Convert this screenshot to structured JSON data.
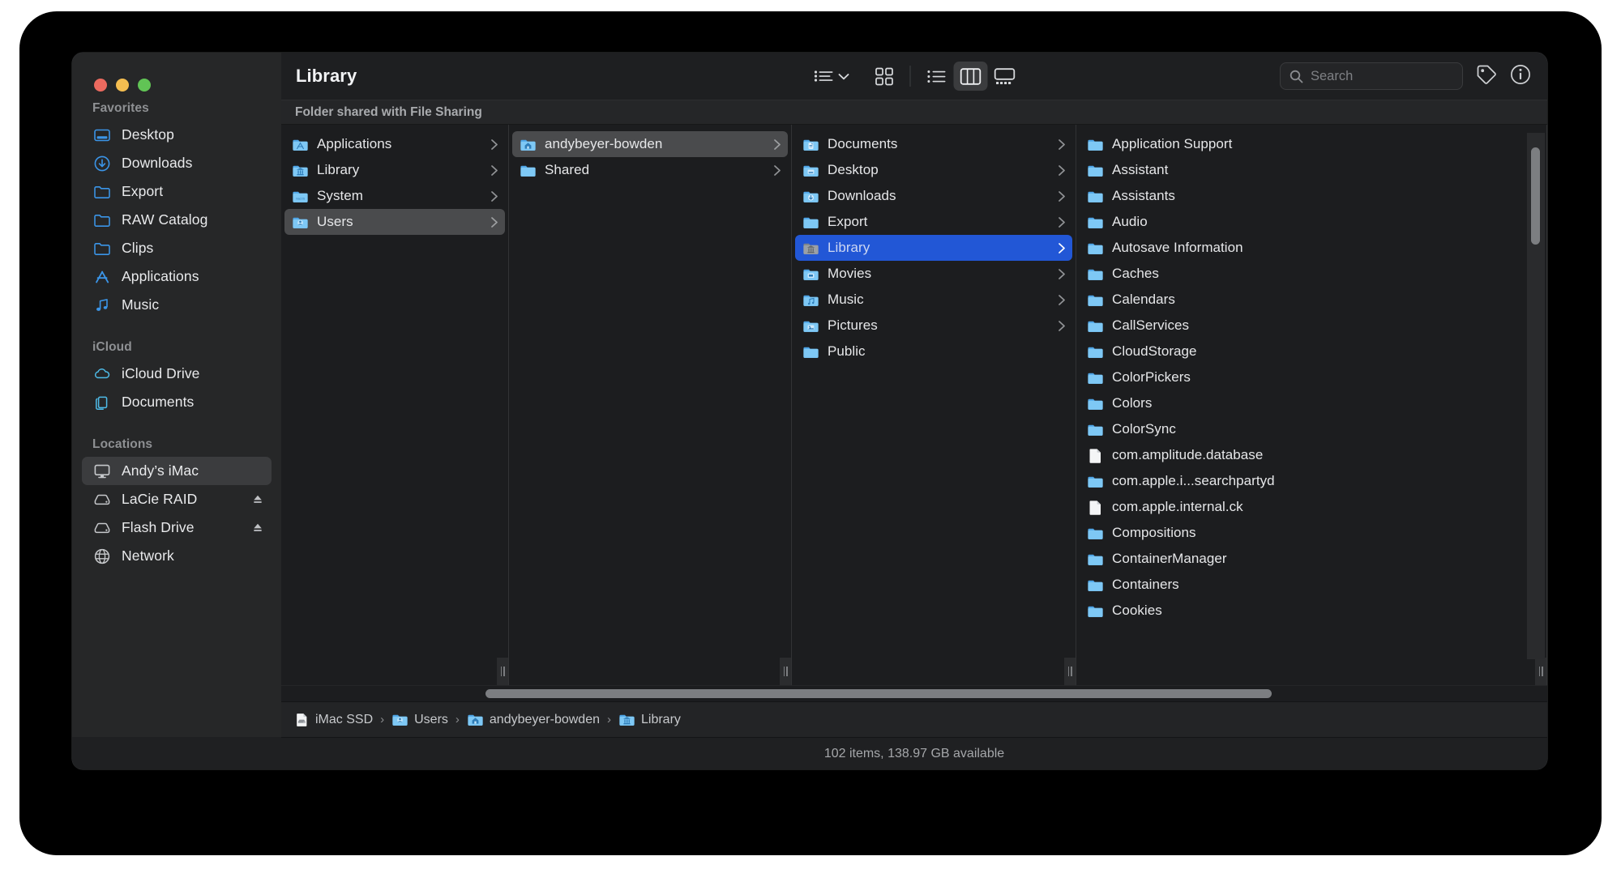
{
  "window": {
    "title": "Library",
    "banner": "Folder shared with File Sharing"
  },
  "traffic_lights": {
    "close": "close-button",
    "minimize": "minimize-button",
    "zoom": "zoom-button",
    "colors": {
      "close": "#ec6a5f",
      "minimize": "#f4bd50",
      "zoom": "#61c455"
    }
  },
  "sidebar": {
    "groups": [
      {
        "title": "Favorites",
        "items": [
          {
            "label": "Desktop",
            "icon": "desktop-icon",
            "selected": false,
            "eject": false
          },
          {
            "label": "Downloads",
            "icon": "downloads-icon",
            "selected": false,
            "eject": false
          },
          {
            "label": "Export",
            "icon": "folder-icon",
            "selected": false,
            "eject": false
          },
          {
            "label": "RAW Catalog",
            "icon": "folder-icon",
            "selected": false,
            "eject": false
          },
          {
            "label": "Clips",
            "icon": "folder-icon",
            "selected": false,
            "eject": false
          },
          {
            "label": "Applications",
            "icon": "applications-icon",
            "selected": false,
            "eject": false
          },
          {
            "label": "Music",
            "icon": "music-note-icon",
            "selected": false,
            "eject": false
          }
        ]
      },
      {
        "title": "iCloud",
        "items": [
          {
            "label": "iCloud Drive",
            "icon": "cloud-icon",
            "selected": false,
            "eject": false
          },
          {
            "label": "Documents",
            "icon": "documents-icon",
            "selected": false,
            "eject": false
          }
        ]
      },
      {
        "title": "Locations",
        "items": [
          {
            "label": "Andy’s iMac",
            "icon": "imac-icon",
            "selected": true,
            "eject": false
          },
          {
            "label": "LaCie RAID",
            "icon": "disk-icon",
            "selected": false,
            "eject": true
          },
          {
            "label": "Flash Drive",
            "icon": "disk-icon",
            "selected": false,
            "eject": true
          },
          {
            "label": "Network",
            "icon": "globe-icon",
            "selected": false,
            "eject": false
          }
        ]
      }
    ]
  },
  "toolbar": {
    "group_button": "group-by-button",
    "chevron": "chevron-down-icon",
    "view_buttons": [
      {
        "name": "icon-view-button",
        "active": false
      },
      {
        "name": "list-view-button",
        "active": false
      },
      {
        "name": "column-view-button",
        "active": true
      },
      {
        "name": "gallery-view-button",
        "active": false
      }
    ],
    "search_placeholder": "Search",
    "tag_button": "tag-icon",
    "info_button": "info-icon"
  },
  "columns": [
    {
      "name": "column-1",
      "items": [
        {
          "label": "Applications",
          "icon": "folder-applications",
          "chevron": true,
          "selected": "none"
        },
        {
          "label": "Library",
          "icon": "folder-library",
          "chevron": true,
          "selected": "none"
        },
        {
          "label": "System",
          "icon": "folder-system",
          "chevron": true,
          "selected": "none"
        },
        {
          "label": "Users",
          "icon": "folder-users",
          "chevron": true,
          "selected": "gray"
        }
      ]
    },
    {
      "name": "column-2",
      "items": [
        {
          "label": "andybeyer-bowden",
          "icon": "folder-home",
          "chevron": true,
          "selected": "gray"
        },
        {
          "label": "Shared",
          "icon": "folder-plain",
          "chevron": true,
          "selected": "none"
        }
      ]
    },
    {
      "name": "column-3",
      "items": [
        {
          "label": "Documents",
          "icon": "folder-documents",
          "chevron": true,
          "selected": "none"
        },
        {
          "label": "Desktop",
          "icon": "folder-desktop",
          "chevron": true,
          "selected": "none"
        },
        {
          "label": "Downloads",
          "icon": "folder-downloads",
          "chevron": true,
          "selected": "none"
        },
        {
          "label": "Export",
          "icon": "folder-plain",
          "chevron": true,
          "selected": "none"
        },
        {
          "label": "Library",
          "icon": "folder-library-dim",
          "chevron": true,
          "selected": "blue"
        },
        {
          "label": "Movies",
          "icon": "folder-movies",
          "chevron": true,
          "selected": "none"
        },
        {
          "label": "Music",
          "icon": "folder-music",
          "chevron": true,
          "selected": "none"
        },
        {
          "label": "Pictures",
          "icon": "folder-pictures",
          "chevron": true,
          "selected": "none"
        },
        {
          "label": "Public",
          "icon": "folder-plain",
          "chevron": false,
          "selected": "none"
        }
      ]
    },
    {
      "name": "column-4",
      "items": [
        {
          "label": "Application Support",
          "icon": "folder-plain",
          "chevron": true,
          "selected": "none"
        },
        {
          "label": "Assistant",
          "icon": "folder-plain",
          "chevron": true,
          "selected": "none"
        },
        {
          "label": "Assistants",
          "icon": "folder-plain",
          "chevron": true,
          "selected": "none"
        },
        {
          "label": "Audio",
          "icon": "folder-plain",
          "chevron": true,
          "selected": "none"
        },
        {
          "label": "Autosave Information",
          "icon": "folder-plain",
          "chevron": true,
          "selected": "none"
        },
        {
          "label": "Caches",
          "icon": "folder-plain",
          "chevron": true,
          "selected": "none"
        },
        {
          "label": "Calendars",
          "icon": "folder-plain",
          "chevron": true,
          "selected": "none"
        },
        {
          "label": "CallServices",
          "icon": "folder-plain",
          "chevron": true,
          "selected": "none"
        },
        {
          "label": "CloudStorage",
          "icon": "folder-plain",
          "chevron": true,
          "selected": "none"
        },
        {
          "label": "ColorPickers",
          "icon": "folder-plain",
          "chevron": true,
          "selected": "none"
        },
        {
          "label": "Colors",
          "icon": "folder-plain",
          "chevron": true,
          "selected": "none"
        },
        {
          "label": "ColorSync",
          "icon": "folder-plain",
          "chevron": true,
          "selected": "none"
        },
        {
          "label": "com.amplitude.database",
          "icon": "file-icon",
          "chevron": false,
          "selected": "none"
        },
        {
          "label": "com.apple.i...searchpartyd",
          "icon": "folder-plain",
          "chevron": true,
          "selected": "none"
        },
        {
          "label": "com.apple.internal.ck",
          "icon": "file-icon",
          "chevron": true,
          "selected": "none"
        },
        {
          "label": "Compositions",
          "icon": "folder-plain",
          "chevron": true,
          "selected": "none"
        },
        {
          "label": "ContainerManager",
          "icon": "folder-plain",
          "chevron": true,
          "selected": "none"
        },
        {
          "label": "Containers",
          "icon": "folder-plain",
          "chevron": true,
          "selected": "none"
        },
        {
          "label": "Cookies",
          "icon": "folder-plain",
          "chevron": true,
          "selected": "none"
        }
      ]
    }
  ],
  "pathbar": [
    {
      "label": "iMac SSD",
      "icon": "disk-file-icon"
    },
    {
      "label": "Users",
      "icon": "folder-users"
    },
    {
      "label": "andybeyer-bowden",
      "icon": "folder-home"
    },
    {
      "label": "Library",
      "icon": "folder-library"
    }
  ],
  "statusbar": {
    "text": "102 items, 138.97 GB available"
  },
  "colors": {
    "accent_blue": "#2257d6",
    "folder_blue": "#4aa8e8",
    "sidebar_bg": "#262728",
    "window_bg": "#1e1f21",
    "column_bg": "#1c1d1f"
  }
}
